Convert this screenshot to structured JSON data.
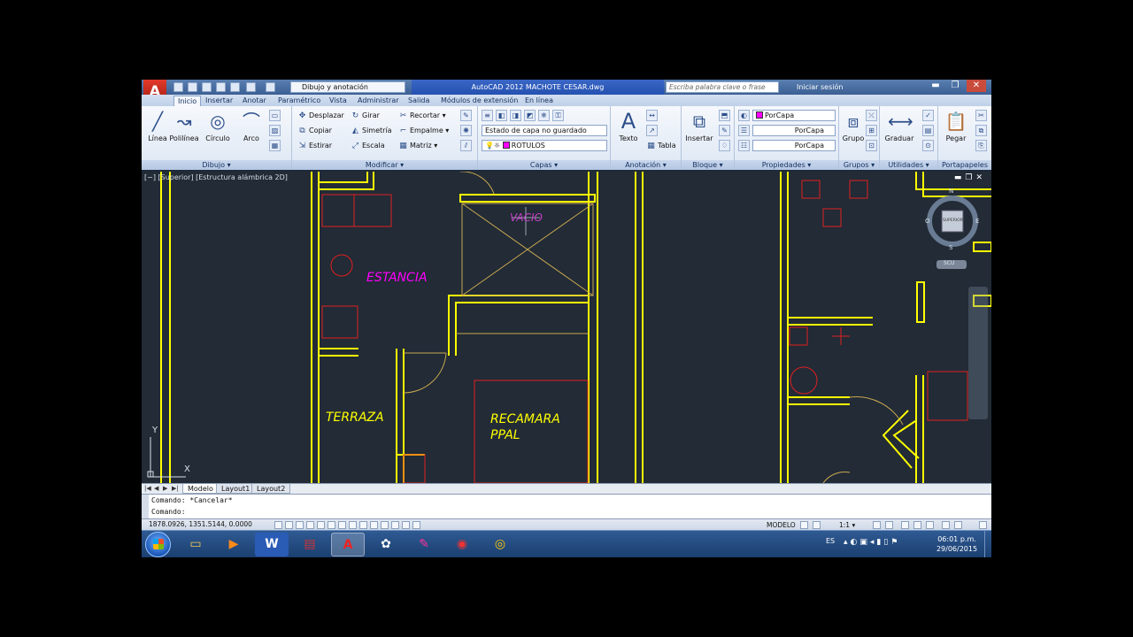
{
  "titlebar": {
    "workspace": "Dibujo y anotación",
    "window_title": "AutoCAD 2012    MACHOTE CESAR.dwg",
    "search_placeholder": "Escriba palabra clave o frase",
    "login": "Iniciar sesión",
    "minimize": "▬",
    "maximize": "❐",
    "close": "✕"
  },
  "ribbon_tabs": [
    "Inicio",
    "Insertar",
    "Anotar",
    "Paramétrico",
    "Vista",
    "Administrar",
    "Salida",
    "Módulos de extensión",
    "En línea"
  ],
  "ribbon": {
    "dibujo": {
      "title": "Dibujo ▾",
      "linea": "Línea",
      "polilinea": "Polilínea",
      "circulo": "Círculo",
      "arco": "Arco"
    },
    "modificar": {
      "title": "Modificar ▾",
      "desplazar": "Desplazar",
      "girar": "Girar",
      "recortar": "Recortar ▾",
      "copiar": "Copiar",
      "simetria": "Simetría",
      "empalme": "Empalme ▾",
      "estirar": "Estirar",
      "escala": "Escala",
      "matriz": "Matriz ▾"
    },
    "capas": {
      "title": "Capas ▾",
      "estado": "Estado de capa no guardado",
      "capa": "ROTULOS"
    },
    "anotacion": {
      "title": "Anotación ▾",
      "texto": "Texto",
      "tabla": "Tabla"
    },
    "bloque": {
      "title": "Bloque ▾",
      "insertar": "Insertar"
    },
    "propiedades": {
      "title": "Propiedades ▾",
      "color": "PorCapa",
      "tipolinea": "PorCapa",
      "grosor": "PorCapa"
    },
    "grupos": {
      "title": "Grupos ▾",
      "grupo": "Grupo"
    },
    "utilidades": {
      "title": "Utilidades ▾",
      "graduar": "Graduar"
    },
    "portapapeles": {
      "title": "Portapapeles",
      "pegar": "Pegar"
    }
  },
  "drawing": {
    "view_label": "[−] [Superior] [Estructura alámbrica 2D]",
    "rooms": {
      "estancia": "ESTANCIA",
      "terraza": "TERRAZA",
      "recamara_1": "RECAMARA",
      "recamara_2": "PPAL",
      "vacio": "VACIO"
    },
    "viewcube": {
      "n": "N",
      "s": "S",
      "e": "E",
      "o": "O",
      "face": "SUPERIOR",
      "ucs": "SCU"
    },
    "axis_y": "Y",
    "axis_x": "X"
  },
  "layout_tabs": [
    "Modelo",
    "Layout1",
    "Layout2"
  ],
  "command": {
    "history": "Comando: *Cancelar*",
    "prompt": "Comando:"
  },
  "status": {
    "coords": "1878.0926, 1351.5144, 0.0000",
    "mode": "MODELO",
    "scale": "1:1 ▾"
  },
  "taskbar": {
    "language": "ES",
    "time": "06:01 p.m.",
    "date": "29/06/2015"
  },
  "colors": {
    "walls": "#ffff00",
    "furniture": "#ff0000",
    "labels_room": "#ff00ff",
    "labels_text": "#ffff00",
    "background": "#222b36"
  }
}
